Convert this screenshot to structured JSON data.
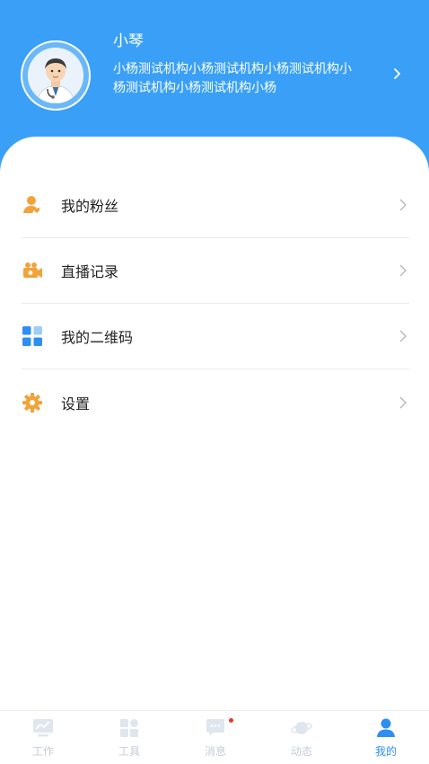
{
  "profile": {
    "name": "小琴",
    "organization": "小杨测试机构小杨测试机构小杨测试机构小杨测试机构小杨测试机构小杨"
  },
  "menu": {
    "items": [
      {
        "label": "我的粉丝",
        "icon": "fans-icon",
        "color": "#f2a33a"
      },
      {
        "label": "直播记录",
        "icon": "live-camera-icon",
        "color": "#f2a33a"
      },
      {
        "label": "我的二维码",
        "icon": "qrcode-grid-icon",
        "color": "#2f8ff0"
      },
      {
        "label": "设置",
        "icon": "gear-icon",
        "color": "#f2a33a"
      }
    ]
  },
  "tabbar": {
    "tabs": [
      {
        "label": "工作",
        "icon": "chart-icon"
      },
      {
        "label": "工具",
        "icon": "tools-grid-icon"
      },
      {
        "label": "消息",
        "icon": "message-icon",
        "badge": true
      },
      {
        "label": "动态",
        "icon": "planet-icon"
      },
      {
        "label": "我的",
        "icon": "user-icon",
        "active": true
      }
    ]
  },
  "colors": {
    "header": "#3aa0f7",
    "accent": "#2e8ff0",
    "badge": "#e33a2a"
  }
}
